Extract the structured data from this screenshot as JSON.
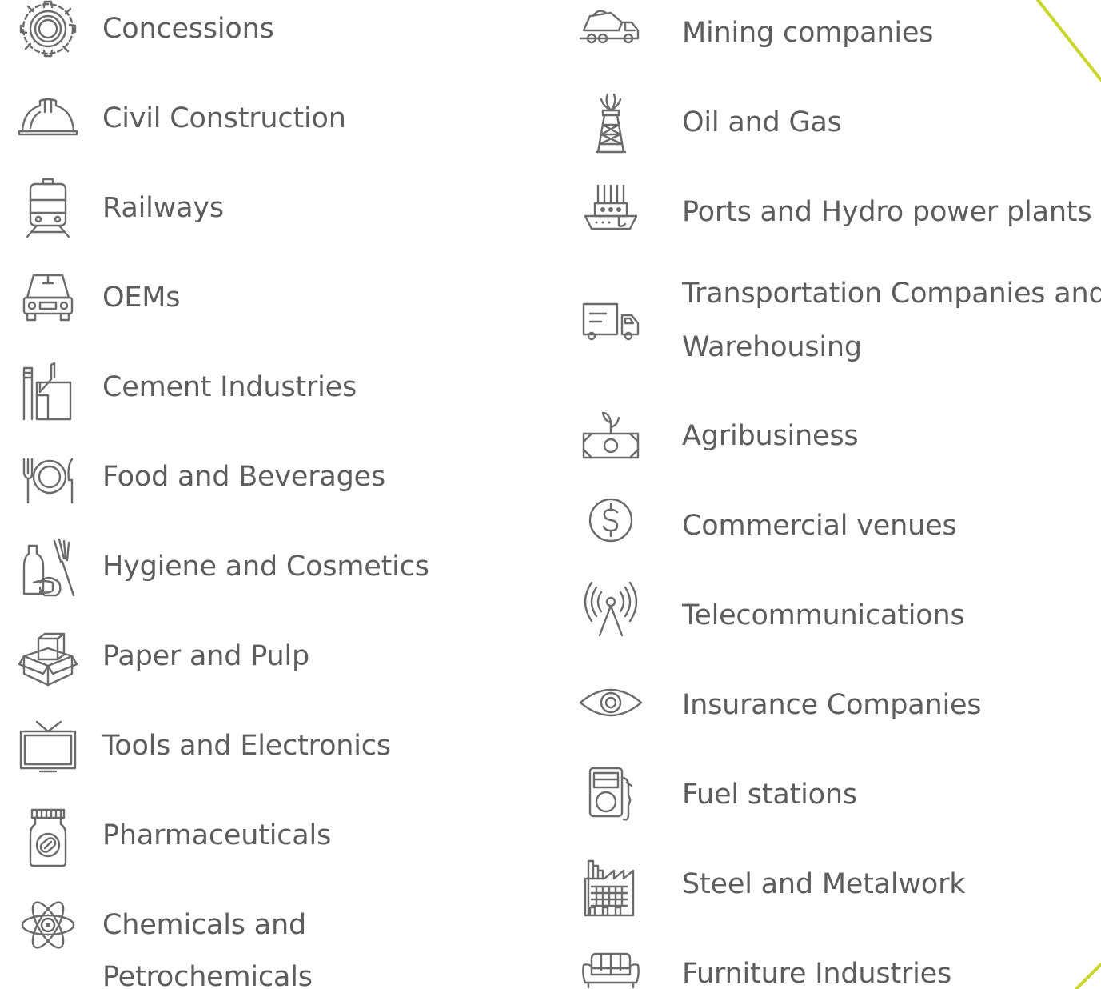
{
  "left_column": [
    {
      "label": "Concessions",
      "icon": "gear-icon"
    },
    {
      "label": "Civil Construction",
      "icon": "hard-hat-icon"
    },
    {
      "label": "Railways",
      "icon": "train-icon"
    },
    {
      "label": "OEMs",
      "icon": "car-icon"
    },
    {
      "label": "Cement Industries",
      "icon": "factory-icon"
    },
    {
      "label": "Food and Beverages",
      "icon": "plate-cutlery-icon"
    },
    {
      "label": "Hygiene and Cosmetics",
      "icon": "cosmetics-icon"
    },
    {
      "label": "Paper and Pulp",
      "icon": "box-icon"
    },
    {
      "label": "Tools and Electronics",
      "icon": "tv-icon"
    },
    {
      "label": "Pharmaceuticals",
      "icon": "pill-jar-icon"
    },
    {
      "label_line1": "Chemicals and",
      "label_line2": "Petrochemicals",
      "icon": "atom-icon"
    }
  ],
  "right_column": [
    {
      "label": "Mining companies",
      "icon": "dump-truck-icon"
    },
    {
      "label": "Oil and Gas",
      "icon": "oil-rig-icon"
    },
    {
      "label": "Ports and Hydro power plants",
      "icon": "ship-icon"
    },
    {
      "label_line1": "Transportation Companies and",
      "label_line2": "Warehousing",
      "icon": "delivery-truck-icon"
    },
    {
      "label": "Agribusiness",
      "icon": "money-plant-icon"
    },
    {
      "label": "Commercial venues",
      "icon": "dollar-coin-icon"
    },
    {
      "label": "Telecommunications",
      "icon": "antenna-icon"
    },
    {
      "label": "Insurance Companies",
      "icon": "eye-icon"
    },
    {
      "label": "Fuel stations",
      "icon": "fuel-pump-icon"
    },
    {
      "label": "Steel and Metalwork",
      "icon": "steel-factory-icon"
    },
    {
      "label": "Furniture Industries",
      "icon": "sofa-icon"
    }
  ],
  "colors": {
    "text": "#5d5d5d",
    "icon": "#6b6b6b",
    "accent": "#c8d62b",
    "background": "#ffffff"
  }
}
